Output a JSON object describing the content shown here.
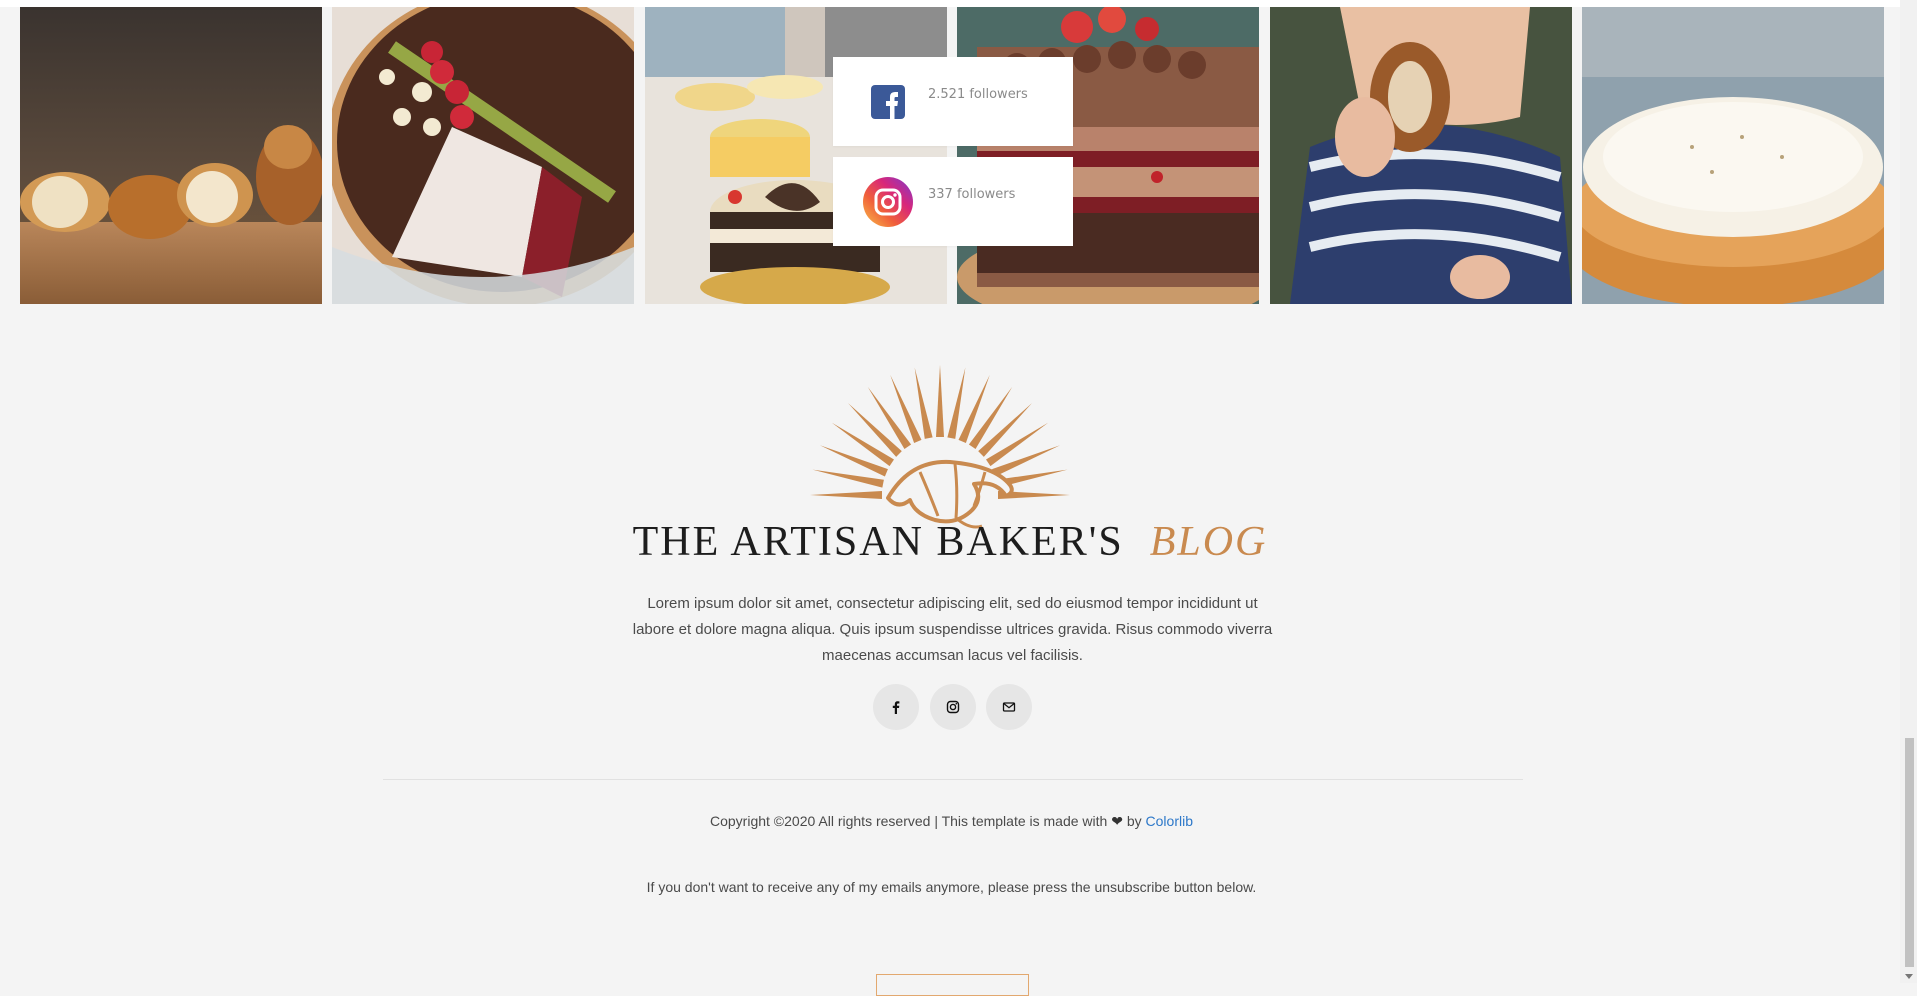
{
  "gallery": {
    "items": [
      {
        "subject": "croissants on wood board"
      },
      {
        "subject": "chocolate raspberry tart"
      },
      {
        "subject": "bakery cake display"
      },
      {
        "subject": "layered chocolate cake"
      },
      {
        "subject": "child eating croissant"
      },
      {
        "subject": "lemon meringue pie"
      }
    ]
  },
  "social": {
    "facebook": {
      "followers": "2.521 followers",
      "icon": "facebook-icon",
      "color": "#3b5998"
    },
    "instagram": {
      "followers": "337 followers",
      "icon": "instagram-icon"
    }
  },
  "footer": {
    "brand_name": "THE ARTISAN BAKER'S",
    "brand_accent": "BLOG",
    "accent_color": "#c98a4f",
    "description": "Lorem ipsum dolor sit amet, consectetur adipiscing elit, sed do eiusmod tempor incididunt ut labore et dolore magna aliqua. Quis ipsum suspendisse ultrices gravida. Risus commodo viverra maecenas accumsan lacus vel facilisis.",
    "social_icons": [
      "facebook-icon",
      "instagram-icon",
      "mail-icon"
    ],
    "copyright_prefix": "Copyright ©2020 All rights reserved | This template is made with",
    "copyright_by": "by",
    "copyright_link": "Colorlib",
    "unsubscribe_note": "If you don't want to receive any of my emails anymore, please press the unsubscribe button below."
  }
}
